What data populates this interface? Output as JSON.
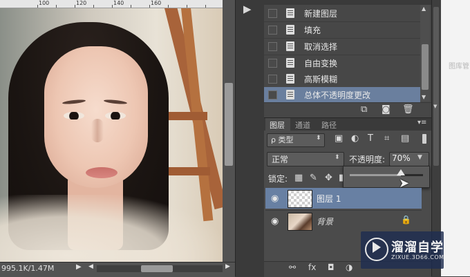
{
  "ruler": {
    "labels": [
      "100",
      "120",
      "140",
      "160"
    ]
  },
  "status": {
    "doc_size": "995.1K/1.47M"
  },
  "history": {
    "items": [
      {
        "label": "新建图层"
      },
      {
        "label": "填充"
      },
      {
        "label": "取消选择"
      },
      {
        "label": "自由变换"
      },
      {
        "label": "高斯模糊"
      },
      {
        "label": "总体不透明度更改"
      }
    ],
    "selected_index": 5
  },
  "layers_panel": {
    "tabs": [
      "图层",
      "通道",
      "路径"
    ],
    "active_tab": "图层",
    "filter_label": "ρ 类型",
    "blend_mode": "正常",
    "opacity_label": "不透明度:",
    "opacity_value": "70%",
    "opacity_fraction": 0.7,
    "lock_label": "锁定:",
    "layers": [
      {
        "name": "图层 1",
        "selected": true
      },
      {
        "name": "背景",
        "selected": false,
        "locked": true
      }
    ]
  },
  "outer": {
    "text": "图库管"
  },
  "watermark": {
    "title": "溜溜自学",
    "subtitle": "ZIXUE.3D66.COM"
  },
  "colors": {
    "selection": "#6a7f9e",
    "panel": "#474747",
    "background": "#3b3b3b"
  },
  "icons": [
    "play-icon",
    "document-icon",
    "eye-icon",
    "lock-icon",
    "link-icon",
    "fx-icon",
    "mask-icon",
    "adjustment-icon",
    "folder-icon",
    "new-layer-icon",
    "trash-icon",
    "camera-icon",
    "brush-icon",
    "move-icon",
    "image-filter-icon",
    "text-filter-icon"
  ]
}
